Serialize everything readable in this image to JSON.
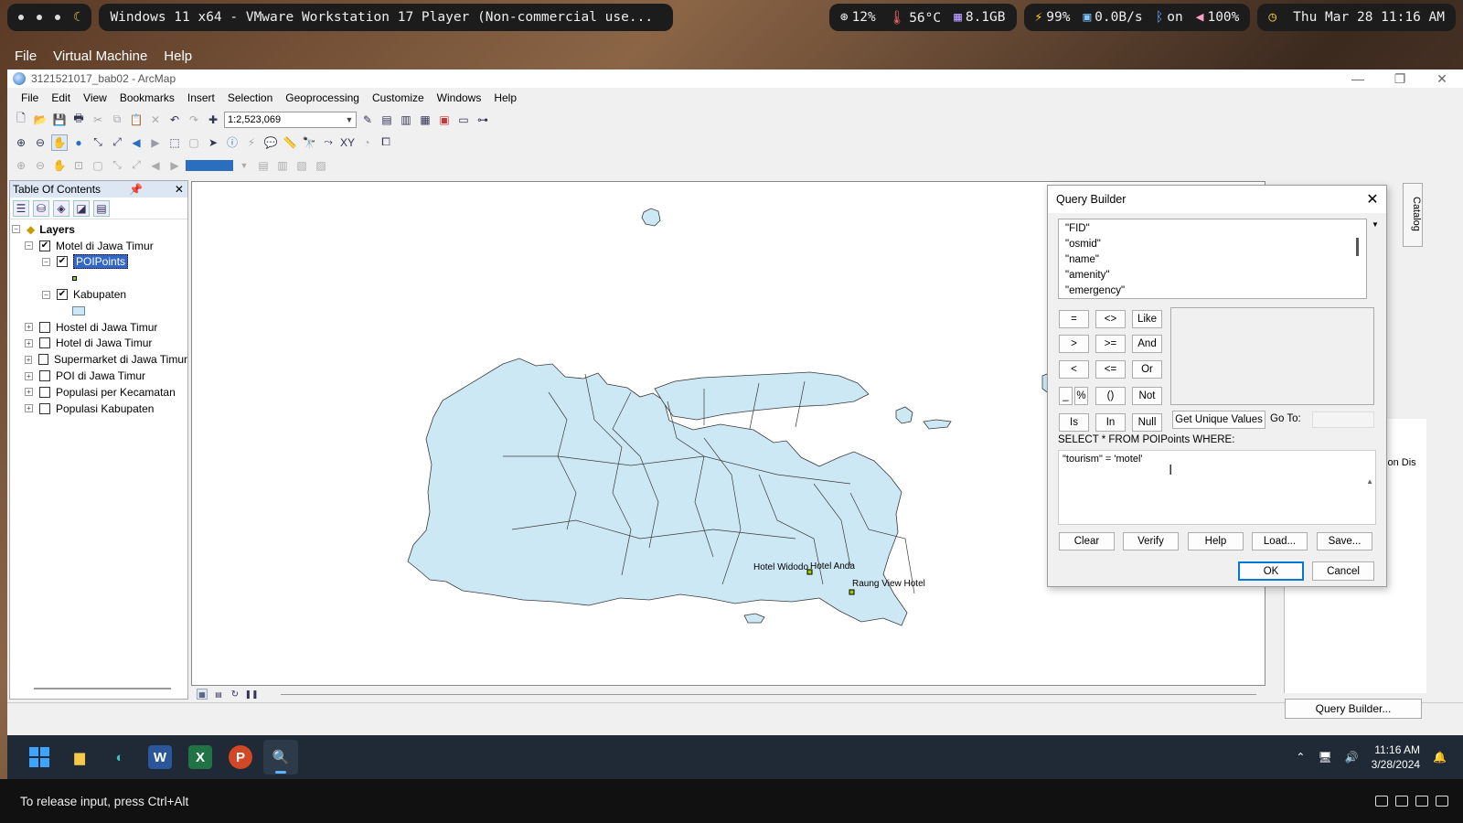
{
  "host": {
    "workspace_dots": 3,
    "window_title": "Windows 11 x64 - VMware Workstation 17 Player (Non-commercial use...",
    "cpu": "12%",
    "temp": "56°C",
    "mem": "8.1GB",
    "battery": "99%",
    "net": "0.0B/s",
    "bt": "on",
    "volume": "100%",
    "datetime": "Thu Mar 28 11:16 AM"
  },
  "vm_menu": [
    "File",
    "Virtual Machine",
    "Help"
  ],
  "arcmap": {
    "title": "3121521017_bab02 - ArcMap",
    "menu": [
      "File",
      "Edit",
      "View",
      "Bookmarks",
      "Insert",
      "Selection",
      "Geoprocessing",
      "Customize",
      "Windows",
      "Help"
    ],
    "scale": "1:2,523,069",
    "toc_title": "Table Of Contents",
    "layers_root": "Layers",
    "group": "Motel di Jawa Timur",
    "layer_poi": "POIPoints",
    "layer_kab": "Kabupaten",
    "layers": [
      "Hostel di Jawa Timur",
      "Hotel di Jawa Timur",
      "Supermarket di Jawa Timur",
      "POI di Jawa Timur",
      "Populasi per Kecamatan",
      "Populasi Kabupaten"
    ],
    "map_labels": [
      "Hotel Widodo",
      "Hotel Anda",
      "Raung View Hotel"
    ],
    "catalog_tab": "Catalog",
    "props_tabs": "tion   Dis",
    "query_builder_button": "Query Builder..."
  },
  "query_builder": {
    "title": "Query Builder",
    "fields": [
      "\"FID\"",
      "\"osmid\"",
      "\"name\"",
      "\"amenity\"",
      "\"emergency\""
    ],
    "ops": [
      "=",
      "<>",
      "Like",
      ">",
      ">=",
      "And",
      "<",
      "<=",
      "Or",
      "_",
      "%",
      "()",
      "Not",
      "Is",
      "In",
      "Null"
    ],
    "unique_values": "Get Unique Values",
    "goto_label": "Go To:",
    "sql_label": "SELECT * FROM POIPoints WHERE:",
    "sql_text": "\"tourism\" = 'motel'",
    "buttons": [
      "Clear",
      "Verify",
      "Help",
      "Load...",
      "Save..."
    ],
    "ok": "OK",
    "cancel": "Cancel"
  },
  "taskbar": {
    "time": "11:16 AM",
    "date": "3/28/2024"
  },
  "vm_status": "To release input, press Ctrl+Alt"
}
